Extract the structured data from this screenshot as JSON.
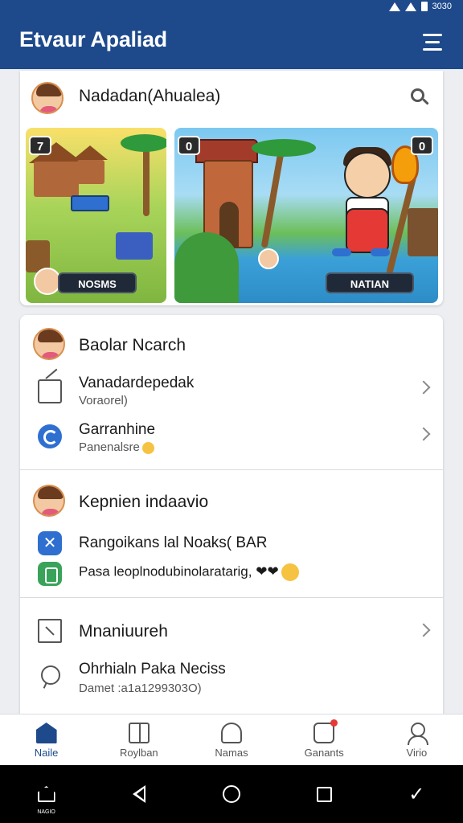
{
  "status_bar": {
    "time": "3030"
  },
  "app_bar": {
    "title": "Etvaur Apaliad"
  },
  "featured": {
    "header": "Nadadan(Ahualea)",
    "cards": [
      {
        "badge": "7",
        "label": "NOSMS"
      },
      {
        "badge": "0",
        "label": "NATIAN"
      }
    ]
  },
  "sections": [
    {
      "title": "Baolar Ncarch",
      "items": [
        {
          "title": "Vanadardepedak",
          "subtitle": "Voraorel)",
          "icon": "edit-doc-icon",
          "has_chevron": true
        },
        {
          "title": "Garranhine",
          "subtitle": "Panenalsre",
          "icon": "sync-icon",
          "has_chevron": true
        }
      ]
    },
    {
      "title": "Kepnien indaavio",
      "items": [
        {
          "title": "Rangoikans lal Noaks( BAR",
          "icon": "x-tool-icon"
        },
        {
          "title": "Pasa leoplnodubinolaratarig, ❤❤",
          "icon": "clipboard-icon"
        }
      ]
    },
    {
      "title": "Mnaniuureh",
      "has_chevron": true,
      "items": [
        {
          "title": "Ohrhialn Paka Neciss",
          "subtitle": "Damet :a1a1299303O)",
          "icon": "chat-bubble-icon"
        }
      ]
    }
  ],
  "bottom_nav": [
    {
      "label": "Naile",
      "icon": "home-icon",
      "active": true
    },
    {
      "label": "Roylban",
      "icon": "book-icon"
    },
    {
      "label": "Namas",
      "icon": "hill-icon"
    },
    {
      "label": "Ganants",
      "icon": "game-icon"
    },
    {
      "label": "Virio",
      "icon": "user-icon"
    }
  ],
  "system_nav": {
    "home_label": "NAGIO"
  },
  "colors": {
    "primary": "#1e4a8c",
    "accent_blue": "#2f6fd0",
    "accent_green": "#3aa35a",
    "background": "#eceef2"
  }
}
